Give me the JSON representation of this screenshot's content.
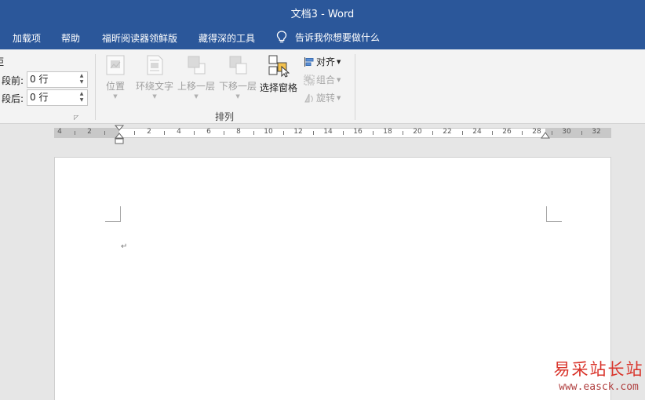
{
  "window": {
    "title": "文档3  -  Word"
  },
  "tabs": [
    "加载项",
    "帮助",
    "福昕阅读器领鲜版",
    "藏得深的工具"
  ],
  "tell_me": "告诉我你想要做什么",
  "paragraph": {
    "before_label": "段前:",
    "before_value": "0 行",
    "after_label": "段后:",
    "after_value": "0 行",
    "cut_label": "距"
  },
  "arrange": {
    "group_label": "排列",
    "position": "位置",
    "wrap_text": "环绕文字",
    "bring_forward": "上移一层",
    "send_backward": "下移一层",
    "selection_pane": "选择窗格",
    "align": "对齐",
    "group": "组合",
    "rotate": "旋转"
  },
  "ruler": {
    "numbers": [
      "4",
      "2",
      "2",
      "4",
      "6",
      "8",
      "10",
      "12",
      "14",
      "16",
      "18",
      "20",
      "22",
      "24",
      "26",
      "28",
      "30",
      "32"
    ]
  },
  "document": {
    "paragraph_mark": "↵"
  },
  "watermark": {
    "cn": "易采站长站",
    "url": "www.easck.com"
  }
}
